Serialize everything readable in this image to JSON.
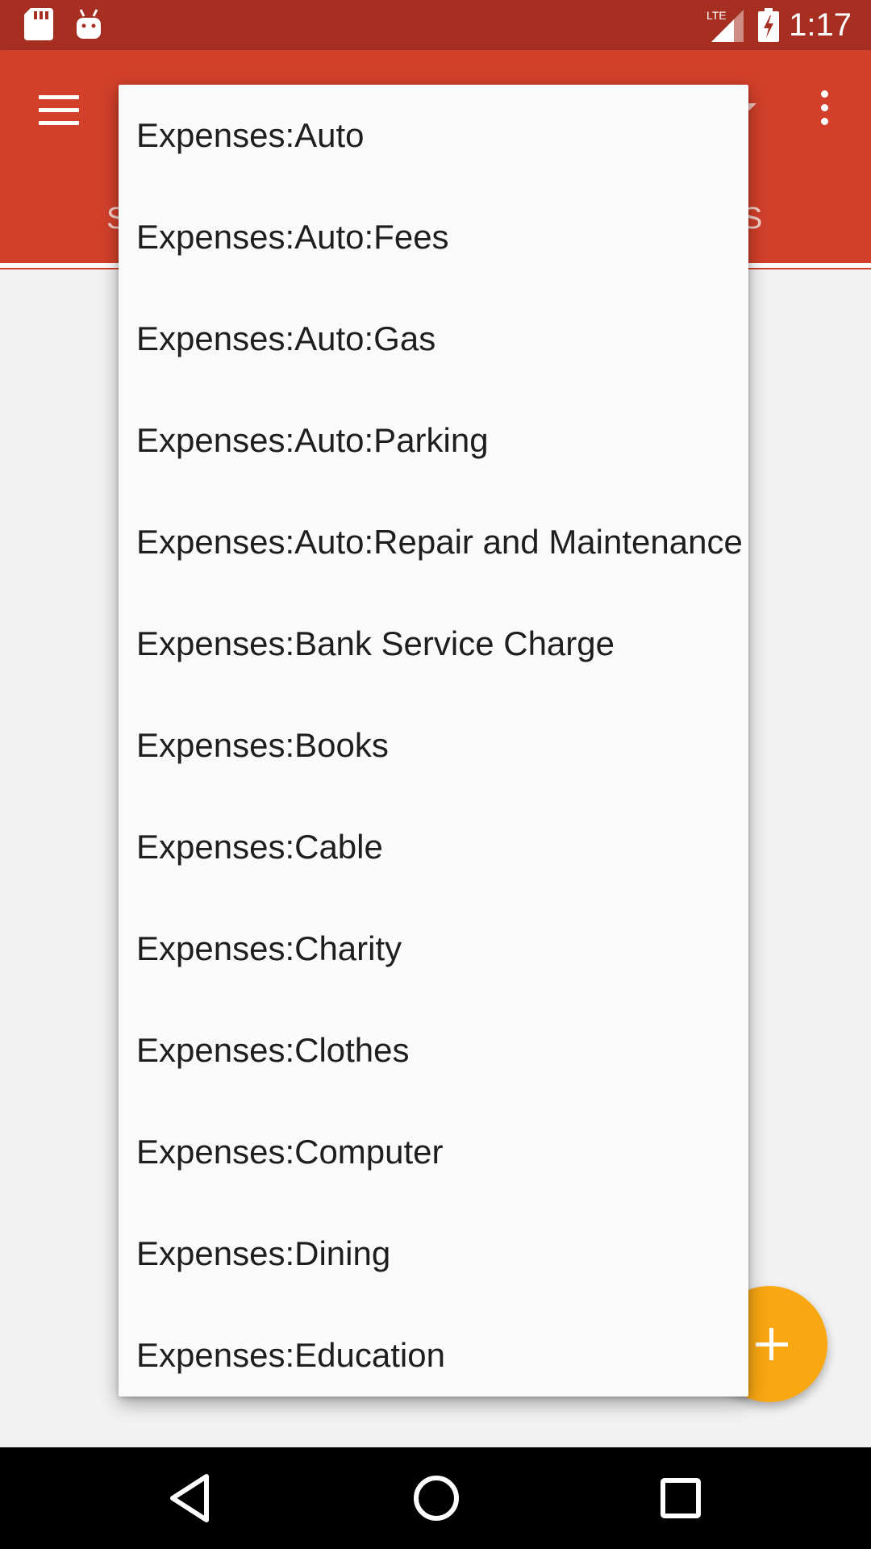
{
  "status_bar": {
    "time": "1:17",
    "network": "LTE",
    "icons": [
      "sd-card-icon",
      "android-debug-icon",
      "signal-icon",
      "battery-charging-icon"
    ]
  },
  "app_bar": {
    "tab_left_partial": "S",
    "tab_right_partial": "S",
    "menu_icon": "hamburger-menu-icon",
    "overflow_icon": "more-vert-icon"
  },
  "popup": {
    "items": [
      {
        "label": "Expenses:Auto"
      },
      {
        "label": "Expenses:Auto:Fees"
      },
      {
        "label": "Expenses:Auto:Gas"
      },
      {
        "label": "Expenses:Auto:Parking"
      },
      {
        "label": "Expenses:Auto:Repair and Maintenance"
      },
      {
        "label": "Expenses:Bank Service Charge"
      },
      {
        "label": "Expenses:Books"
      },
      {
        "label": "Expenses:Cable"
      },
      {
        "label": "Expenses:Charity"
      },
      {
        "label": "Expenses:Clothes"
      },
      {
        "label": "Expenses:Computer"
      },
      {
        "label": "Expenses:Dining"
      },
      {
        "label": "Expenses:Education"
      }
    ]
  },
  "fab": {
    "icon": "plus-icon"
  },
  "nav_bar": {
    "icons": [
      "back-icon",
      "home-icon",
      "recents-icon"
    ]
  },
  "colors": {
    "status_bar": "#a72f22",
    "app_bar": "#d2402b",
    "fab": "#f9a812",
    "popup_bg": "#fafafa"
  }
}
